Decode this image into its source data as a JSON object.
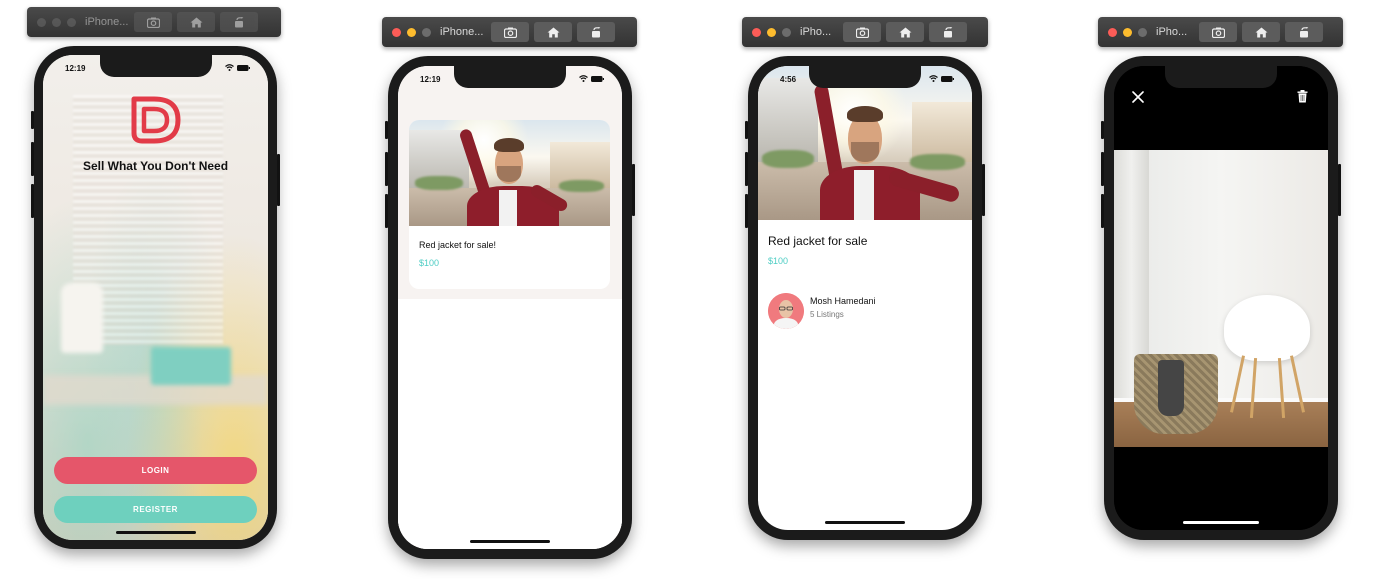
{
  "simulators": [
    {
      "title": "iPhone...",
      "status_time": "12:19"
    },
    {
      "title": "iPhone...",
      "status_time": "12:19"
    },
    {
      "title": "iPho...",
      "status_time": "4:56"
    },
    {
      "title": "iPho..."
    }
  ],
  "welcome": {
    "tagline": "Sell What You Don't Need",
    "login_label": "LOGIN",
    "register_label": "REGISTER"
  },
  "listings": {
    "card": {
      "title": "Red jacket for sale!",
      "price": "$100"
    }
  },
  "details": {
    "title": "Red jacket for sale",
    "price": "$100",
    "seller": {
      "name": "Mosh Hamedani",
      "listings": "5 Listings"
    }
  },
  "icons": {
    "toolbar": [
      "screenshot-icon",
      "home-icon",
      "rotate-icon"
    ],
    "viewer": [
      "close-icon",
      "trash-icon"
    ],
    "logo": "app-logo-icon"
  },
  "colors": {
    "primary": "#fc5c65",
    "secondary": "#4ecdc4",
    "price": "#4ecdc4",
    "device_frame": "#1b1b1b",
    "toolbar": "#3a3a3a"
  }
}
